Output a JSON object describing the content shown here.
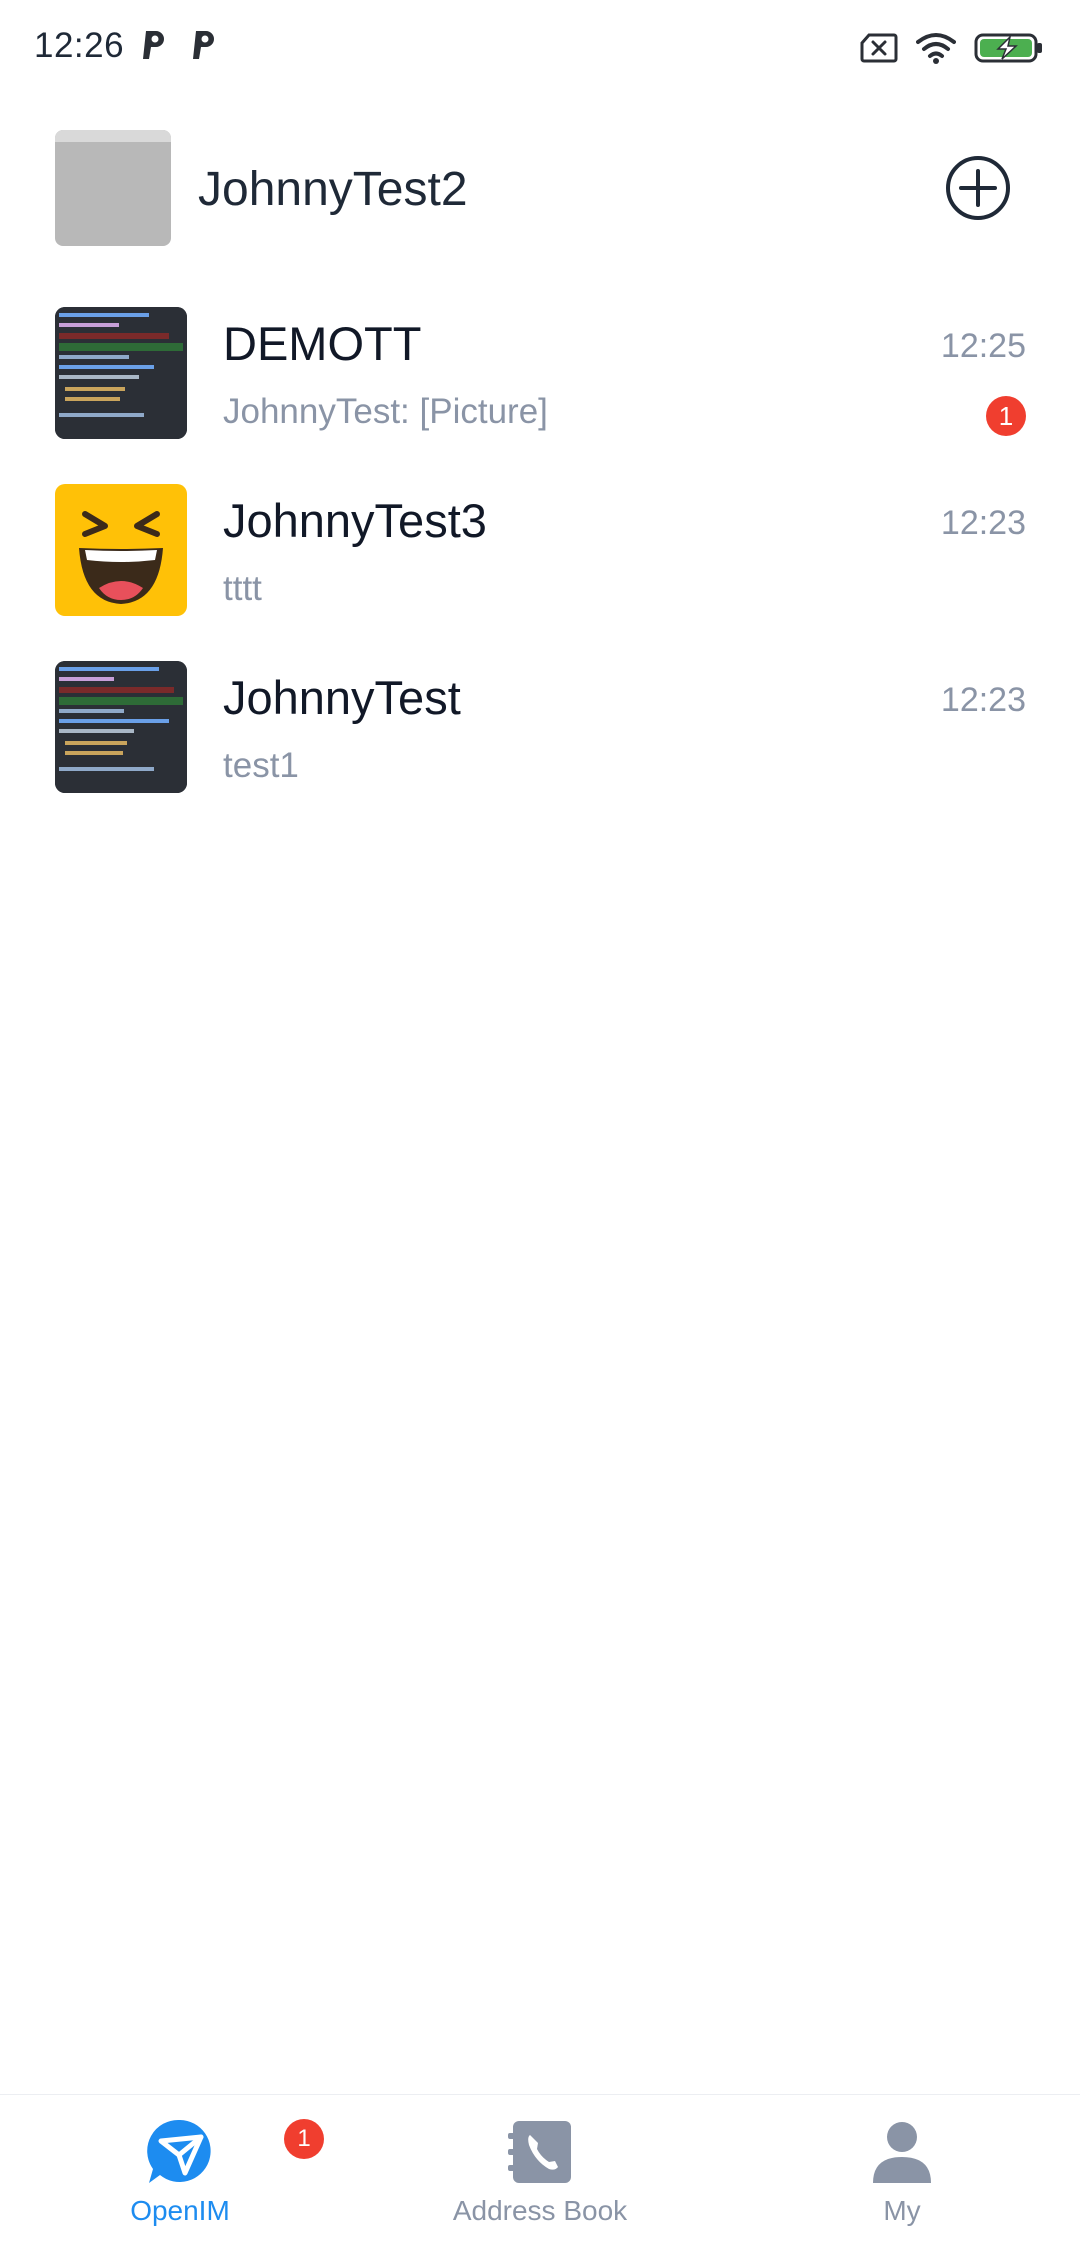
{
  "status_bar": {
    "time": "12:26",
    "left_icons": [
      "p-icon",
      "p-icon"
    ],
    "right_icons": [
      "sim-off-icon",
      "wifi-icon",
      "battery-charging-icon"
    ],
    "battery_color": "#4caf50"
  },
  "header": {
    "user_name": "JohnnyTest2",
    "add_icon": "plus-circle-icon"
  },
  "conversations": [
    {
      "name": "DEMOTT",
      "last_message": "JohnnyTest: [Picture]",
      "time": "12:25",
      "unread": "1",
      "avatar": "code-screenshot"
    },
    {
      "name": "JohnnyTest3",
      "last_message": "tttt",
      "time": "12:23",
      "unread": "",
      "avatar": "laughing-emoji"
    },
    {
      "name": "JohnnyTest",
      "last_message": "test1",
      "time": "12:23",
      "unread": "",
      "avatar": "code-screenshot"
    }
  ],
  "bottom_nav": {
    "items": [
      {
        "label": "OpenIM",
        "icon": "openim-icon",
        "active": true,
        "badge": "1"
      },
      {
        "label": "Address Book",
        "icon": "address-book-icon",
        "active": false
      },
      {
        "label": "My",
        "icon": "person-icon",
        "active": false
      }
    ],
    "active_color": "#1d8cf0",
    "inactive_color": "#8a94a6"
  },
  "colors": {
    "badge": "#f03e2f",
    "secondary_text": "#8a94a6"
  }
}
